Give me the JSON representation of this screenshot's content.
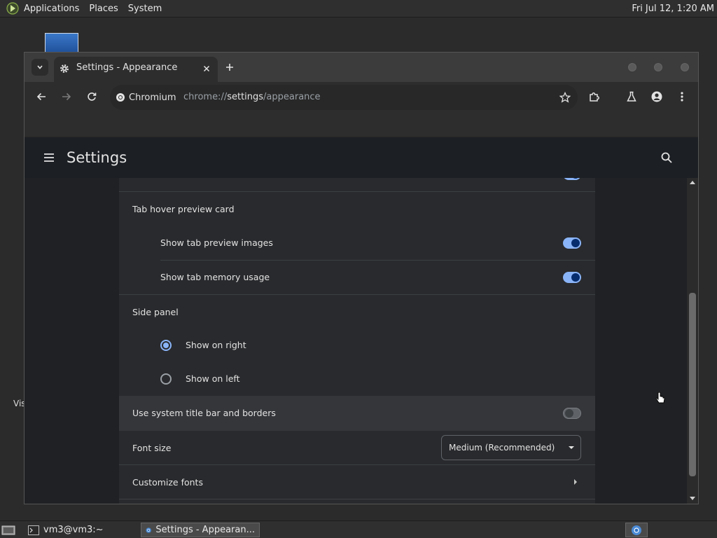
{
  "top_panel": {
    "menus": [
      "Applications",
      "Places",
      "System"
    ],
    "clock": "Fri Jul 12,  1:20 AM"
  },
  "desktop": {
    "icon_label": "Vis"
  },
  "browser": {
    "tab_title": "Settings - Appearance",
    "site_chip": "Chromium",
    "url": {
      "scheme": "chrome://",
      "host": "settings",
      "path": "/appearance"
    }
  },
  "settings": {
    "page_title": "Settings",
    "rows": {
      "tab_hover_preview": "Tab hover preview card",
      "show_tab_preview_images": {
        "label": "Show tab preview images",
        "enabled": true
      },
      "show_tab_memory_usage": {
        "label": "Show tab memory usage",
        "enabled": true
      },
      "side_panel": "Side panel",
      "show_on_right": {
        "label": "Show on right",
        "selected": true
      },
      "show_on_left": {
        "label": "Show on left",
        "selected": false
      },
      "system_title_bar": {
        "label": "Use system title bar and borders",
        "enabled": false
      },
      "font_size": {
        "label": "Font size",
        "value": "Medium (Recommended)"
      },
      "customize_fonts": "Customize fonts"
    }
  },
  "taskbar": {
    "items": [
      "vm3@vm3:~",
      "Settings - Appearan..."
    ]
  },
  "colors": {
    "accent": "#8ab4f8",
    "card": "#292a2d",
    "page": "#202124"
  }
}
